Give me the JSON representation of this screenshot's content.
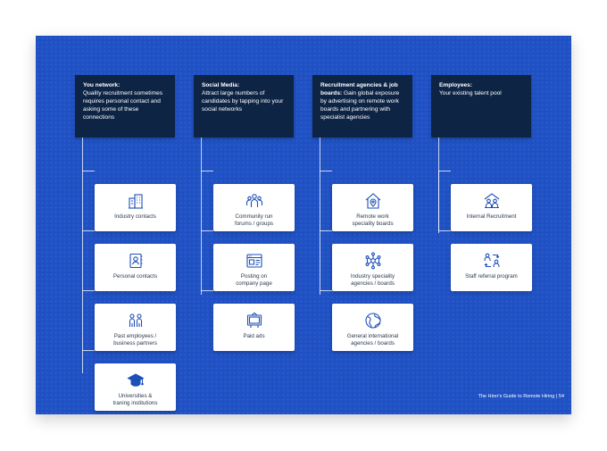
{
  "colors": {
    "page_bg": "#1f51c4",
    "header_bg": "#0d2445",
    "icon_color": "#1d4fb8",
    "card_text": "#2c3a4d"
  },
  "columns": [
    {
      "title": "You network:",
      "body": "Quality recruitment sometimes requires personal contact and asking some of these connections",
      "items": [
        {
          "label": "Industry contacts",
          "icon": "office-buildings-icon"
        },
        {
          "label": "Personal contacts",
          "icon": "contact-book-icon"
        },
        {
          "label": "Past employees /\nbusiness partners",
          "icon": "two-people-icon"
        },
        {
          "label": "Universities &\ntraning institutions",
          "icon": "graduation-cap-icon"
        }
      ]
    },
    {
      "title": "Social Media:",
      "body": "Attract large numbers of candidates by tapping into your social networks",
      "items": [
        {
          "label": "Community run\nforums / groups",
          "icon": "group-people-icon"
        },
        {
          "label": "Posting on\ncompany page",
          "icon": "browser-page-icon"
        },
        {
          "label": "Paid ads",
          "icon": "billboard-icon"
        }
      ]
    },
    {
      "title": "Recruitment agencies & job boards:",
      "body": "Gain global exposure by advertising on remote work boards and partnering with specialist agencies",
      "items": [
        {
          "label": "Remote work\nspeciality boards",
          "icon": "home-location-icon"
        },
        {
          "label": "Industry speciality\nagencies / boards",
          "icon": "network-nodes-icon"
        },
        {
          "label": "General international\nagencies / boards",
          "icon": "globe-icon"
        }
      ]
    },
    {
      "title": "Employees:",
      "body": "Your existing talent pool",
      "items": [
        {
          "label": "Internal Recruitment",
          "icon": "team-building-icon"
        },
        {
          "label": "Staff referral program",
          "icon": "referral-exchange-icon"
        }
      ]
    }
  ],
  "footer": "The Hirer's Guide to Remote Hiring | 54"
}
